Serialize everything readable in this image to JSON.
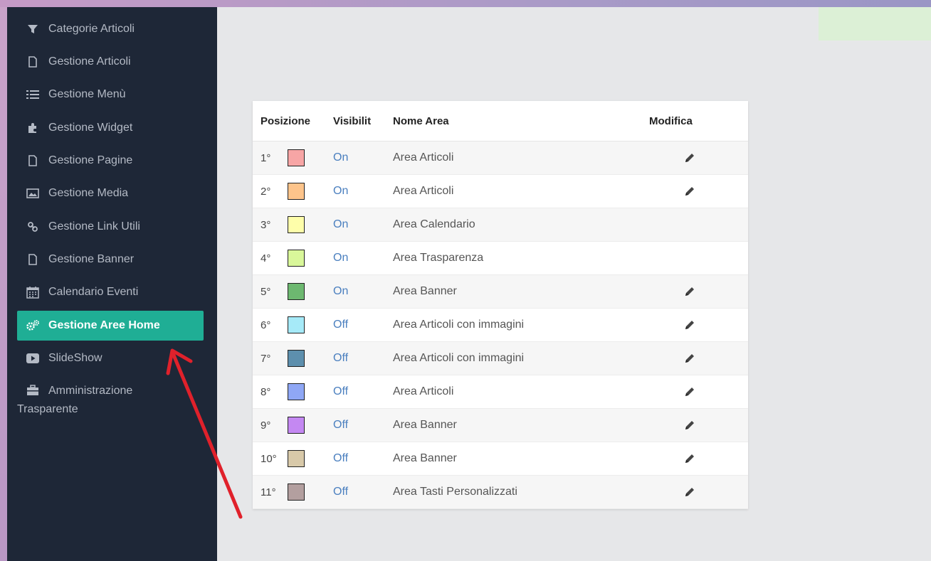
{
  "sidebar": {
    "items": [
      {
        "label": "Categorie Articoli",
        "icon": "filter-icon",
        "active": false
      },
      {
        "label": "Gestione Articoli",
        "icon": "file-icon",
        "active": false
      },
      {
        "label": "Gestione Menù",
        "icon": "list-icon",
        "active": false
      },
      {
        "label": "Gestione Widget",
        "icon": "puzzle-icon",
        "active": false
      },
      {
        "label": "Gestione Pagine",
        "icon": "file-icon",
        "active": false
      },
      {
        "label": "Gestione Media",
        "icon": "image-icon",
        "active": false
      },
      {
        "label": "Gestione Link Utili",
        "icon": "link-icon",
        "active": false
      },
      {
        "label": "Gestione Banner",
        "icon": "file-icon",
        "active": false
      },
      {
        "label": "Calendario Eventi",
        "icon": "calendar-icon",
        "active": false
      },
      {
        "label": "Gestione Aree Home",
        "icon": "gears-icon",
        "active": true
      },
      {
        "label": "SlideShow",
        "icon": "play-icon",
        "active": false
      },
      {
        "label": "Amministrazione",
        "label2": "Trasparente",
        "icon": "briefcase-icon",
        "active": false
      }
    ]
  },
  "table": {
    "headers": {
      "position": "Posizione",
      "visibility": "Visibilit",
      "name": "Nome Area",
      "edit": "Modifica"
    },
    "rows": [
      {
        "pos": "1°",
        "color": "#f7a5a5",
        "vis": "On",
        "name": "Area Articoli",
        "edit": true
      },
      {
        "pos": "2°",
        "color": "#fdc48b",
        "vis": "On",
        "name": "Area Articoli",
        "edit": true
      },
      {
        "pos": "3°",
        "color": "#fefeaa",
        "vis": "On",
        "name": "Area Calendario",
        "edit": false
      },
      {
        "pos": "4°",
        "color": "#d9f79a",
        "vis": "On",
        "name": "Area Trasparenza",
        "edit": false
      },
      {
        "pos": "5°",
        "color": "#6db870",
        "vis": "On",
        "name": "Area Banner",
        "edit": true
      },
      {
        "pos": "6°",
        "color": "#a6eaf8",
        "vis": "Off",
        "name": "Area Articoli con immagini",
        "edit": true
      },
      {
        "pos": "7°",
        "color": "#5d8fad",
        "vis": "Off",
        "name": "Area Articoli con immagini",
        "edit": true
      },
      {
        "pos": "8°",
        "color": "#8fa7f5",
        "vis": "Off",
        "name": "Area Articoli",
        "edit": true
      },
      {
        "pos": "9°",
        "color": "#c488f2",
        "vis": "Off",
        "name": "Area Banner",
        "edit": true
      },
      {
        "pos": "10°",
        "color": "#d8c9a9",
        "vis": "Off",
        "name": "Area Banner",
        "edit": true
      },
      {
        "pos": "11°",
        "color": "#b39f9f",
        "vis": "Off",
        "name": "Area Tasti Personalizzati",
        "edit": true
      }
    ]
  },
  "colors": {
    "sidebar_bg": "#1e2737",
    "active_bg": "#1fae95",
    "link": "#4a7fbf",
    "annotation_arrow": "#e0212b"
  }
}
